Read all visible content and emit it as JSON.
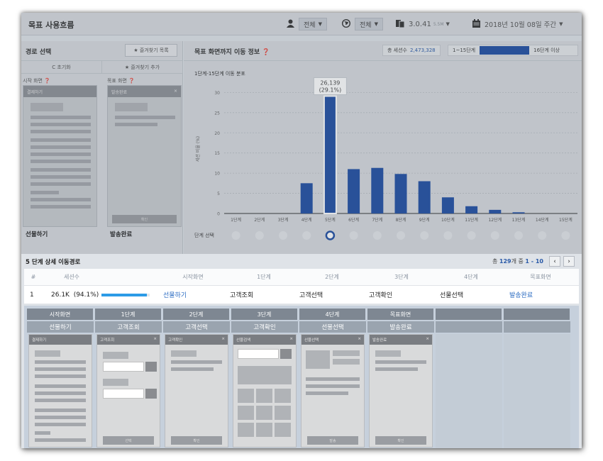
{
  "header": {
    "title": "목표 사용흐름",
    "user_filter": "전체",
    "region_filter": "전체",
    "version": "3.0.41",
    "version_badge": "5.5M",
    "date_label": "2018년 10월 08일 주간"
  },
  "left_panel": {
    "title": "경로 선택",
    "fav_list_button": "★ 즐겨찾기 목록",
    "reset_tab": "C 초기화",
    "add_fav_tab": "★ 즐겨찾기 추가",
    "start_label": "시작 화면",
    "target_label": "목표 화면",
    "start_card_title": "결제하기",
    "target_card_title": "발송완료",
    "target_card_button": "확인",
    "start_value": "선물하기",
    "target_value": "발송완료"
  },
  "main_panel": {
    "title": "목표 화면까지 이동 정보",
    "total_label": "총 세션수",
    "total_value": "2,473,328",
    "range_start": "1~15단계",
    "range_end": "16단계 이상",
    "chart_subtitle": "1단계-15단계 이동 분포",
    "step_select_label": "단계 선택",
    "selected_step_index": 4
  },
  "chart_data": {
    "type": "bar",
    "categories": [
      "1단계",
      "2단계",
      "3단계",
      "4단계",
      "5단계",
      "6단계",
      "7단계",
      "8단계",
      "9단계",
      "10단계",
      "11단계",
      "12단계",
      "13단계",
      "14단계",
      "15단계"
    ],
    "values": [
      0,
      0,
      0,
      7.5,
      29.1,
      11,
      11.3,
      9.8,
      8,
      4,
      1.8,
      0.9,
      0.3,
      0,
      0
    ],
    "ylabel": "세션 비율 (%)",
    "ylim": [
      0,
      32
    ],
    "yticks": [
      0,
      5,
      10,
      15,
      20,
      25,
      30
    ],
    "highlight_index": 4,
    "tooltip_value": "26,139",
    "tooltip_pct": "(29.1%)",
    "bar_color": "#1f4ea3",
    "grid": true
  },
  "detail": {
    "title": "5 단계 상세 이동경로",
    "pager_prefix": "총",
    "pager_total": "129",
    "pager_mid": "개 중",
    "pager_range": "1 - 10",
    "prev": "‹",
    "next": "›",
    "columns": [
      "#",
      "세션수",
      "시작화면",
      "1단계",
      "2단계",
      "3단계",
      "4단계",
      "목표화면"
    ],
    "row": {
      "index": "1",
      "sessions": "26.1K",
      "pct": "(94.1%)",
      "progress": 0.941,
      "start": "선물하기",
      "step1": "고객조회",
      "step2": "고객선택",
      "step3": "고객확인",
      "step4": "선물선택",
      "target": "발송완료"
    }
  },
  "path": {
    "steps": [
      {
        "head": "시작화면",
        "name": "선물하기",
        "card": "결제하기",
        "button": ""
      },
      {
        "head": "1단계",
        "name": "고객조회",
        "card": "고객조회",
        "button": "선택"
      },
      {
        "head": "2단계",
        "name": "고객선택",
        "card": "고객확인",
        "button": "확인"
      },
      {
        "head": "3단계",
        "name": "고객확인",
        "card": "선물검색",
        "button": ""
      },
      {
        "head": "4단계",
        "name": "선물선택",
        "card": "선물선택",
        "button": "발송"
      },
      {
        "head": "목표화면",
        "name": "발송완료",
        "card": "발송완료",
        "button": "확인"
      }
    ],
    "close": "×"
  }
}
